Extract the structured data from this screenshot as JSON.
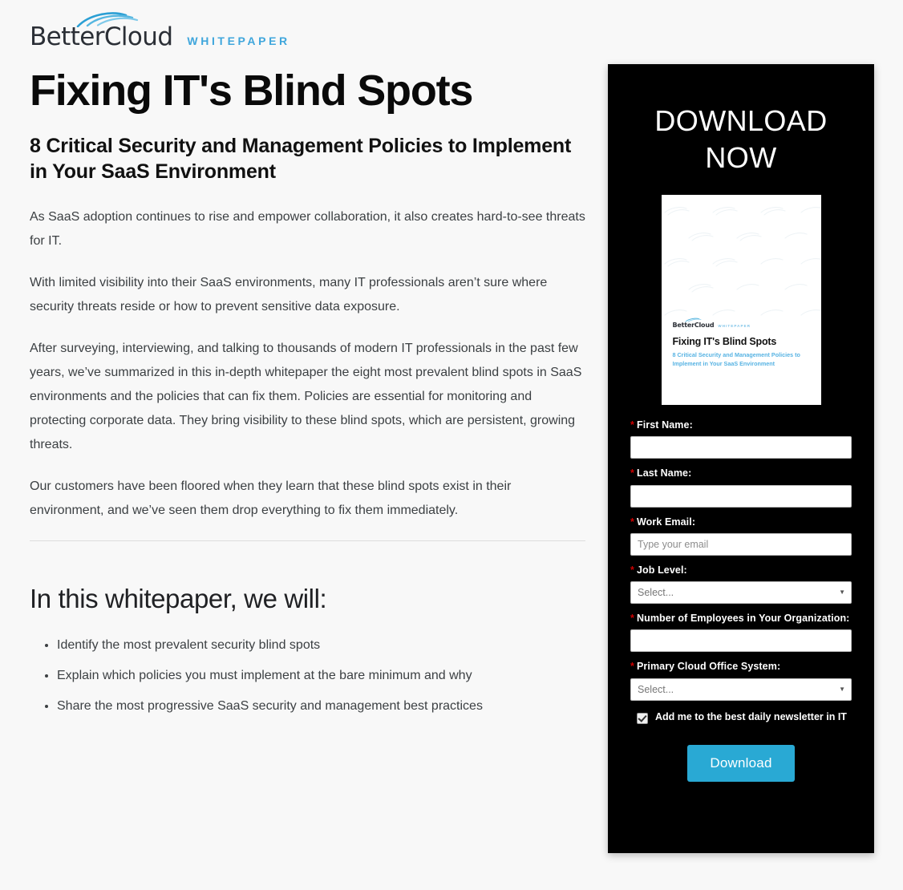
{
  "brand": {
    "logo_text": "BetterCloud",
    "kicker": "WHITEPAPER",
    "accent_blue": "#3fa6dc",
    "button_blue": "#29a9d4",
    "required_red": "#cc0000",
    "panel_black": "#000000",
    "page_background": "#f8f8f8"
  },
  "hero": {
    "title": "Fixing IT's Blind Spots",
    "subtitle": "8 Critical Security and Management Policies to Implement in Your SaaS Environment"
  },
  "body": {
    "paragraphs": [
      "As SaaS adoption continues to rise and empower collaboration, it also creates hard-to-see threats for IT.",
      "With limited visibility into their SaaS environments, many IT professionals aren’t sure where security threats reside or how to prevent sensitive data exposure.",
      "After surveying, interviewing, and talking to thousands of modern IT professionals in the past few years, we’ve summarized in this in-depth whitepaper the eight most prevalent blind spots in SaaS environments and the policies that can fix them. Policies are essential for monitoring and protecting corporate data. They bring visibility to these blind spots, which are persistent, growing threats.",
      "Our customers have been floored when they learn that these blind spots exist in their environment, and we’ve seen them drop everything to fix them immediately."
    ]
  },
  "whitepaper_section": {
    "heading": "In this whitepaper, we will:",
    "bullets": [
      "Identify the most prevalent security blind spots",
      "Explain which policies you must implement at the bare minimum and why",
      "Share the most progressive SaaS security and management best practices"
    ]
  },
  "form_panel": {
    "heading": "DOWNLOAD NOW",
    "cover": {
      "logo_text": "BetterCloud",
      "kicker": "WHITEPAPER",
      "title": "Fixing IT's Blind Spots",
      "subtitle": "8 Critical Security and Management Policies to Implement in Your SaaS Environment"
    },
    "fields": [
      {
        "name": "first-name",
        "label": "First Name:",
        "required_marker": "*",
        "type": "text",
        "value": "",
        "placeholder": ""
      },
      {
        "name": "last-name",
        "label": "Last Name:",
        "required_marker": "*",
        "type": "text",
        "value": "",
        "placeholder": ""
      },
      {
        "name": "work-email",
        "label": "Work Email:",
        "required_marker": "*",
        "type": "text",
        "value": "",
        "placeholder": "Type your email"
      },
      {
        "name": "job-level",
        "label": "Job Level:",
        "required_marker": "*",
        "type": "select",
        "value": "Select...",
        "placeholder": ""
      },
      {
        "name": "number-of-employees",
        "label": "Number of Employees in Your Organization:",
        "required_marker": "*",
        "type": "text",
        "value": "",
        "placeholder": ""
      },
      {
        "name": "primary-cloud-office-system",
        "label": "Primary Cloud Office System:",
        "required_marker": "*",
        "type": "select",
        "value": "Select...",
        "placeholder": ""
      }
    ],
    "newsletter_checkbox": {
      "label": "Add me to the best daily newsletter in IT",
      "checked": true
    },
    "submit_label": "Download",
    "select_caret_glyph": "▼"
  }
}
